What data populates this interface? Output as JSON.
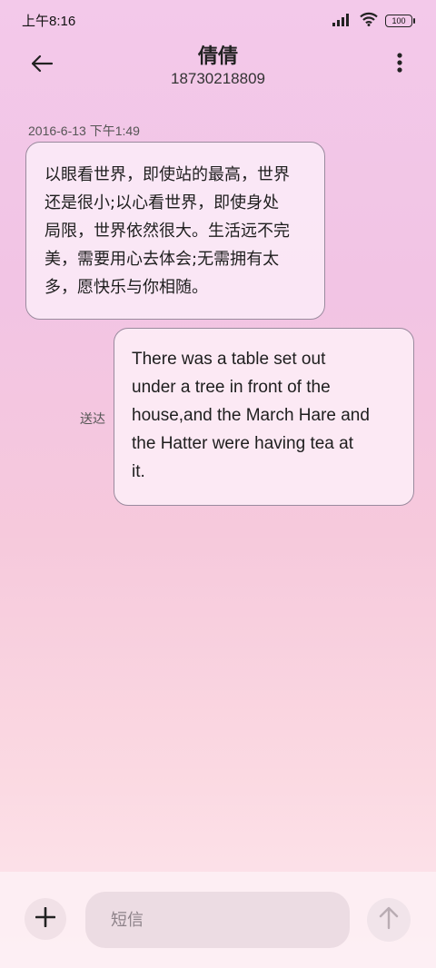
{
  "status_bar": {
    "time": "上午8:16",
    "battery": "100",
    "icons": [
      "signal-icon",
      "wifi-icon",
      "battery-icon"
    ]
  },
  "header": {
    "contact_name": "倩倩",
    "contact_number": "18730218809",
    "back_icon": "arrow-left-icon",
    "menu_icon": "more-vertical-icon"
  },
  "messages": [
    {
      "direction": "incoming",
      "timestamp": "2016-6-13 下午1:49",
      "lines": [
        "以眼看世界，即使站的最高，世界",
        "还是很小;以心看世界，即使身处",
        "局限，世界依然很大。生活远不完",
        "美，需要用心去体会;无需拥有太",
        "多，愿快乐与你相随。"
      ]
    },
    {
      "direction": "outgoing",
      "status": "送达",
      "lines": [
        "There was a table set out",
        "under a tree in front of the",
        "house,and the March Hare and",
        "the Hatter were having tea at",
        "it."
      ]
    }
  ],
  "composer": {
    "placeholder": "短信",
    "value": "",
    "add_icon": "plus-icon",
    "send_icon": "arrow-up-icon"
  }
}
